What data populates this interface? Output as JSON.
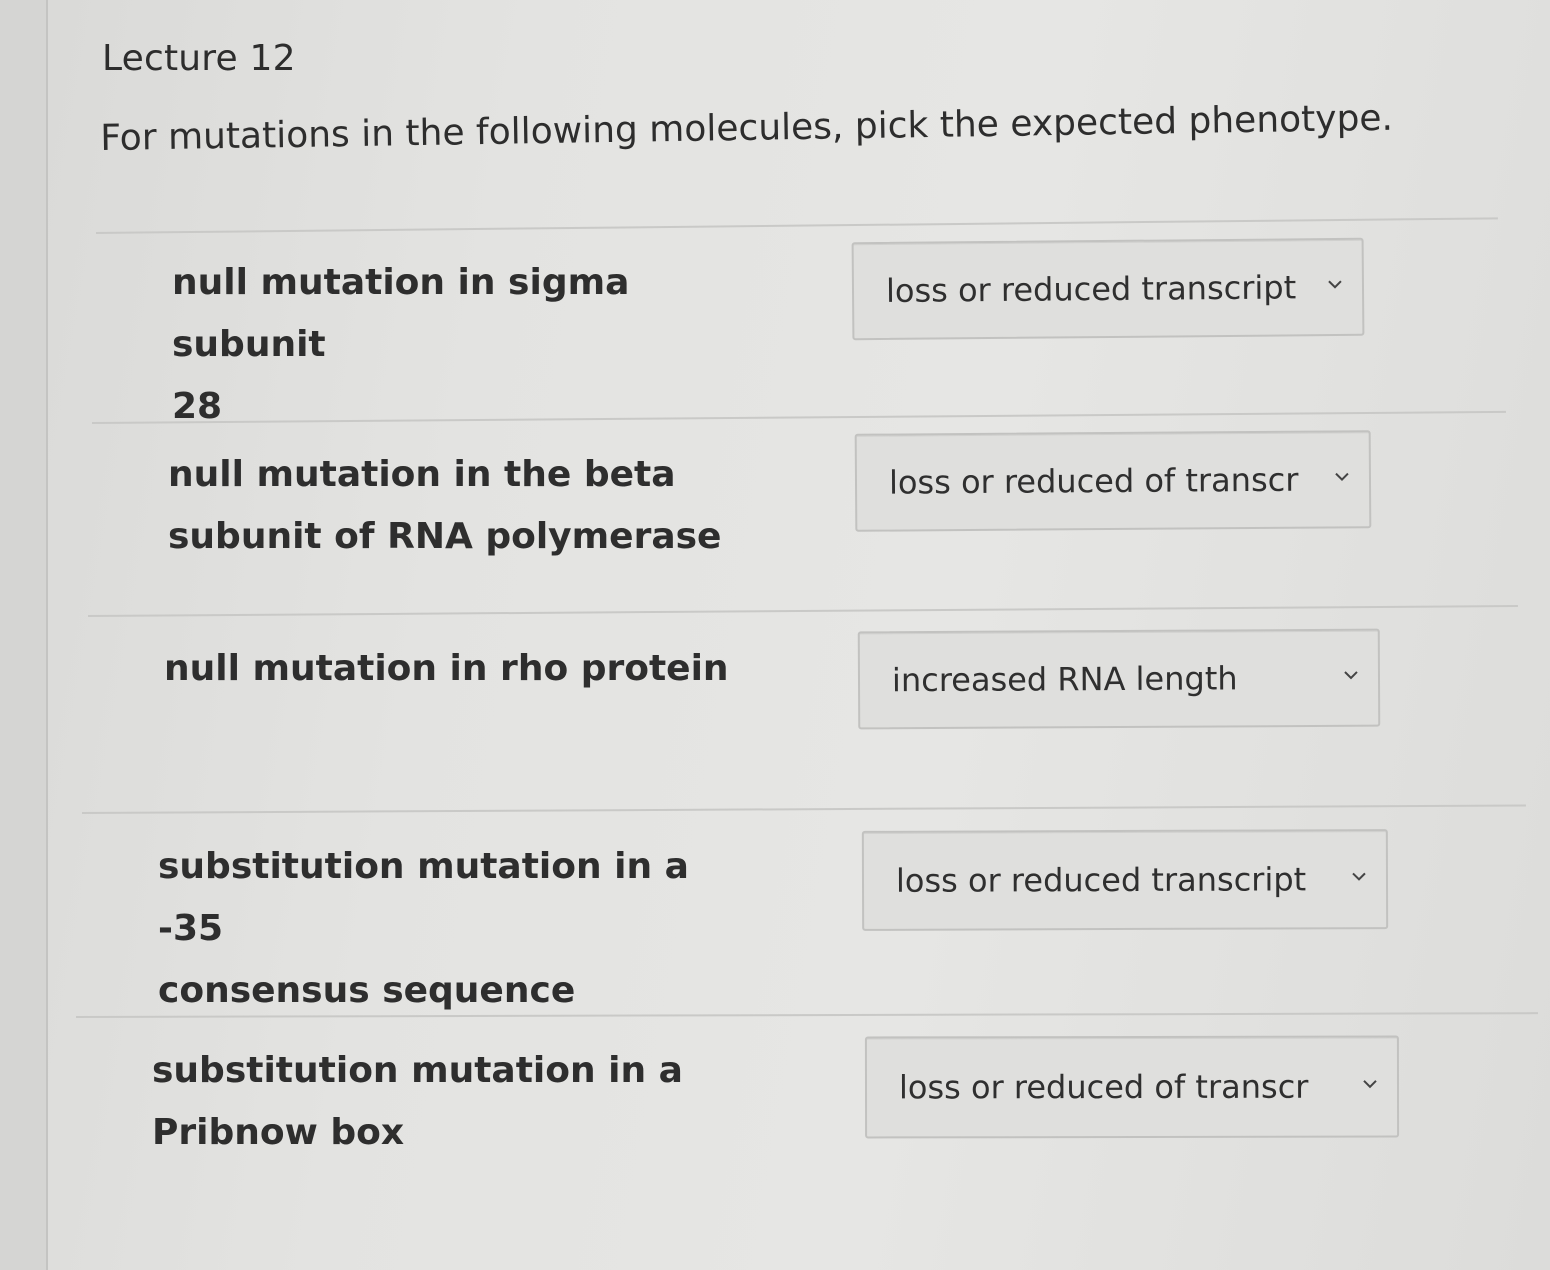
{
  "lecture": {
    "title": "Lecture 12"
  },
  "question": {
    "prompt": "For mutations in the following molecules, pick the expected phenotype."
  },
  "rows": [
    {
      "label": "null mutation in sigma subunit\n28",
      "selected": "loss or reduced transcripti",
      "icon": "chevron-down-icon"
    },
    {
      "label": "null mutation in the beta\nsubunit of RNA polymerase",
      "selected": "loss or reduced of transcri",
      "icon": "chevron-down-icon"
    },
    {
      "label": "null mutation in rho protein",
      "selected": "increased RNA length",
      "icon": "chevron-down-icon"
    },
    {
      "label": "substitution mutation in a -35\nconsensus sequence",
      "selected": "loss or reduced transcripti",
      "icon": "chevron-down-icon"
    },
    {
      "label": "substitution mutation in a\nPribnow box",
      "selected": "loss or reduced of transcri",
      "icon": "chevron-down-icon"
    }
  ]
}
